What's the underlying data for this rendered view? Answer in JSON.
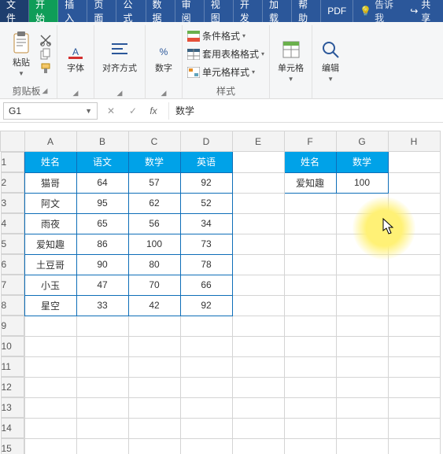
{
  "tabs": {
    "file": "文件",
    "home": "开始",
    "insert": "插入",
    "layout": "页面",
    "formulas": "公式",
    "data": "数据",
    "review": "审阅",
    "view": "视图",
    "dev": "开发",
    "addins": "加载",
    "help": "帮助",
    "pdf": "PDF",
    "tell": "告诉我",
    "share": "共享"
  },
  "ribbon": {
    "clipboard": {
      "paste": "粘贴",
      "label": "剪贴板"
    },
    "font": {
      "label": "字体"
    },
    "align": {
      "label": "对齐方式"
    },
    "number": {
      "label": "数字"
    },
    "styles": {
      "cond": "条件格式",
      "tablefmt": "套用表格格式",
      "cellfmt": "单元格样式",
      "label": "样式"
    },
    "cells": {
      "label": "单元格"
    },
    "editing": {
      "label": "编辑"
    }
  },
  "fx": {
    "name": "G1",
    "cancel": "✕",
    "confirm": "✓",
    "fx": "fx",
    "value": "数学"
  },
  "cols": [
    "A",
    "B",
    "C",
    "D",
    "E",
    "F",
    "G",
    "H"
  ],
  "rows": [
    "1",
    "2",
    "3",
    "4",
    "5",
    "6",
    "7",
    "8",
    "9",
    "10",
    "11",
    "12",
    "13",
    "14",
    "15"
  ],
  "t1_header": [
    "姓名",
    "语文",
    "数学",
    "英语"
  ],
  "t1": [
    [
      "猫哥",
      "64",
      "57",
      "92"
    ],
    [
      "阿文",
      "95",
      "62",
      "52"
    ],
    [
      "雨夜",
      "65",
      "56",
      "34"
    ],
    [
      "爱知趣",
      "86",
      "100",
      "73"
    ],
    [
      "土豆哥",
      "90",
      "80",
      "78"
    ],
    [
      "小玉",
      "47",
      "70",
      "66"
    ],
    [
      "星空",
      "33",
      "42",
      "92"
    ]
  ],
  "t2_header": [
    "姓名",
    "数学"
  ],
  "t2": [
    [
      "爱知趣",
      "100"
    ]
  ],
  "chart_data": {
    "type": "table",
    "tables": [
      {
        "title": "scores",
        "columns": [
          "姓名",
          "语文",
          "数学",
          "英语"
        ],
        "rows": [
          [
            "猫哥",
            64,
            57,
            92
          ],
          [
            "阿文",
            95,
            62,
            52
          ],
          [
            "雨夜",
            65,
            56,
            34
          ],
          [
            "爱知趣",
            86,
            100,
            73
          ],
          [
            "土豆哥",
            90,
            80,
            78
          ],
          [
            "小玉",
            47,
            70,
            66
          ],
          [
            "星空",
            33,
            42,
            92
          ]
        ]
      },
      {
        "title": "lookup",
        "columns": [
          "姓名",
          "数学"
        ],
        "rows": [
          [
            "爱知趣",
            100
          ]
        ]
      }
    ]
  }
}
